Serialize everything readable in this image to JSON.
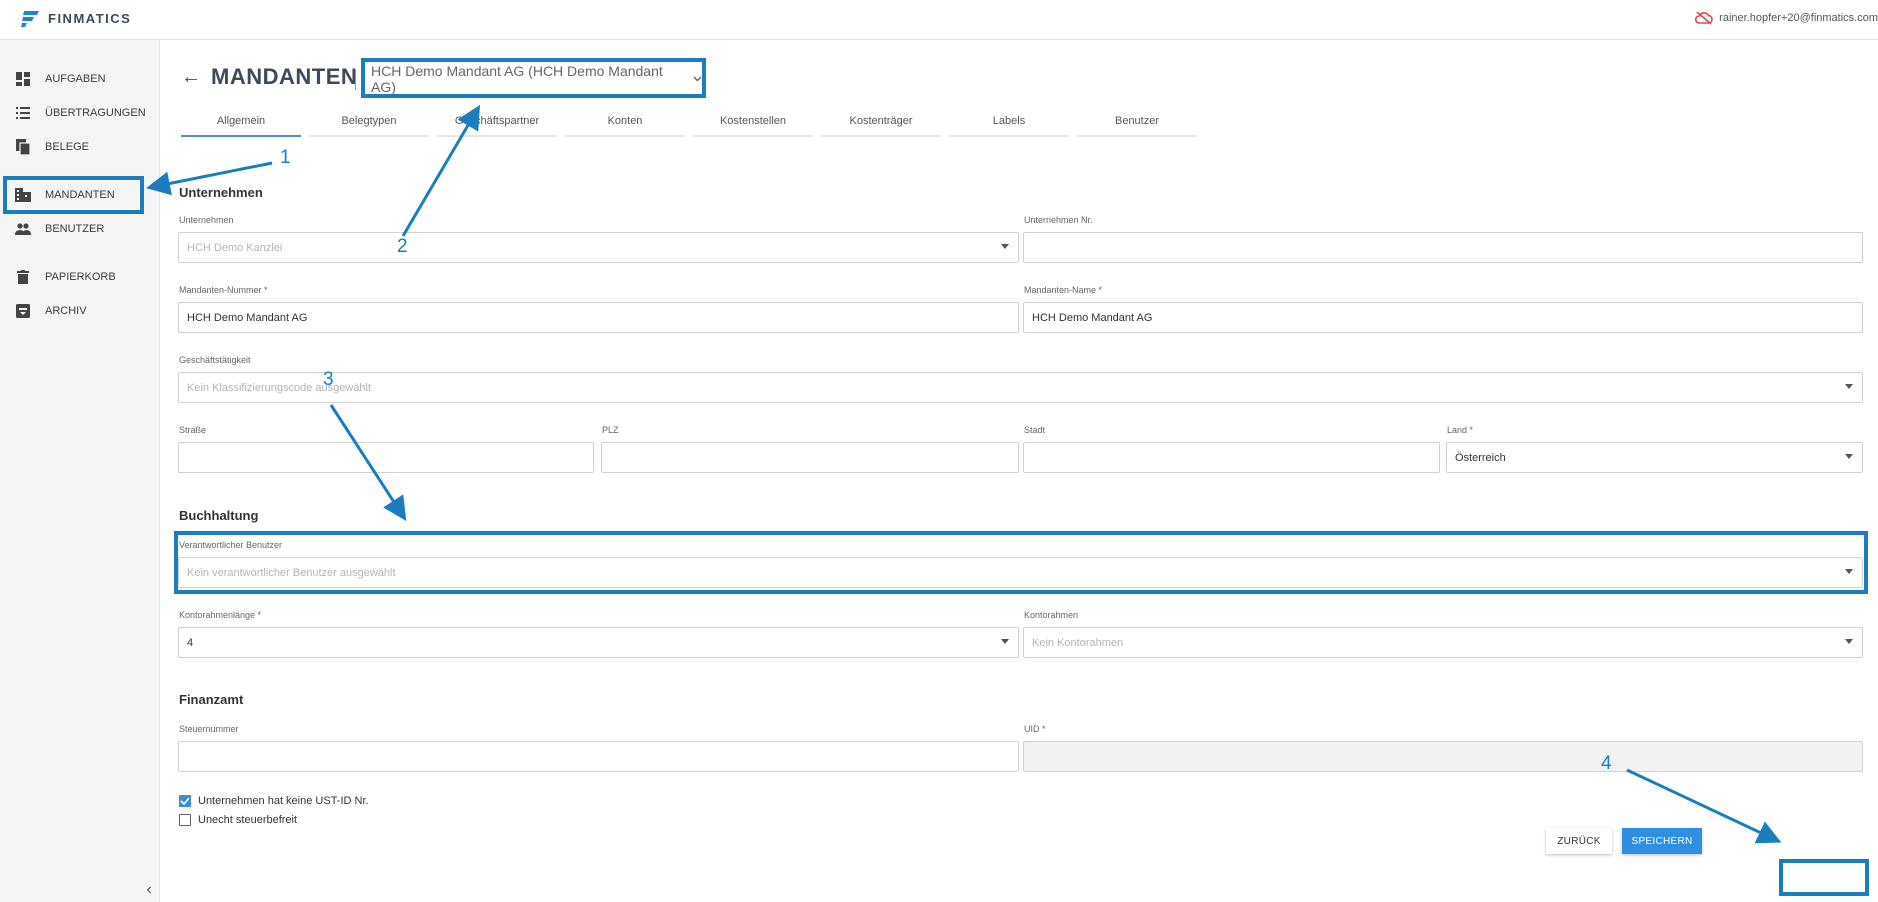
{
  "app": {
    "brand": "FINMATICS",
    "user_email": "rainer.hopfer+20@finmatics.com"
  },
  "sidebar": {
    "items": [
      {
        "label": "AUFGABEN",
        "icon": "dashboard-icon"
      },
      {
        "label": "ÜBERTRAGUNGEN",
        "icon": "list-icon"
      },
      {
        "label": "BELEGE",
        "icon": "documents-icon"
      },
      {
        "label": "MANDANTEN",
        "icon": "building-icon"
      },
      {
        "label": "BENUTZER",
        "icon": "people-icon"
      },
      {
        "label": "PAPIERKORB",
        "icon": "trash-icon"
      },
      {
        "label": "ARCHIV",
        "icon": "archive-icon"
      }
    ],
    "collapse": "‹"
  },
  "page": {
    "back": "←",
    "title": "MANDANTEN",
    "client_select": "HCH Demo Mandant AG (HCH Demo Mandant AG)"
  },
  "tabs": [
    "Allgemein",
    "Belegtypen",
    "Geschäftspartner",
    "Konten",
    "Kostenstellen",
    "Kostenträger",
    "Labels",
    "Benutzer"
  ],
  "unternehmen": {
    "heading": "Unternehmen",
    "company_label": "Unternehmen",
    "company_value": "HCH Demo Kanzlei",
    "company_nr_label": "Unternehmen Nr.",
    "company_nr_value": "",
    "client_number_label": "Mandanten-Nummer *",
    "client_number_value": "HCH Demo Mandant AG",
    "client_name_label": "Mandanten-Name *",
    "client_name_value": "HCH Demo Mandant AG",
    "business_label": "Geschäftstätigkeit",
    "business_placeholder": "Kein Klassifizierungscode ausgewählt",
    "street_label": "Straße",
    "zip_label": "PLZ",
    "city_label": "Stadt",
    "country_label": "Land *",
    "country_value": "Österreich"
  },
  "buchhaltung": {
    "heading": "Buchhaltung",
    "responsible_label": "Verantwortlicher Benutzer",
    "responsible_placeholder": "Kein verantwortlicher Benutzer ausgewählt",
    "chart_length_label": "Kontorahmenlänge *",
    "chart_length_value": "4",
    "chart_label": "Kontorahmen",
    "chart_placeholder": "Kein Kontorahmen"
  },
  "finanzamt": {
    "heading": "Finanzamt",
    "tax_number_label": "Steuernummer",
    "uid_label": "UID *",
    "no_ust_label": "Unternehmen hat keine UST-ID Nr.",
    "no_ust_checked": true,
    "tax_exempt_label": "Unecht steuerbefreit",
    "tax_exempt_checked": false
  },
  "actions": {
    "back_label": "ZURÜCK",
    "save_label": "SPEICHERN"
  },
  "annotations": {
    "n1": "1",
    "n2": "2",
    "n3": "3",
    "n4": "4",
    "color": "#1b7dbd"
  }
}
